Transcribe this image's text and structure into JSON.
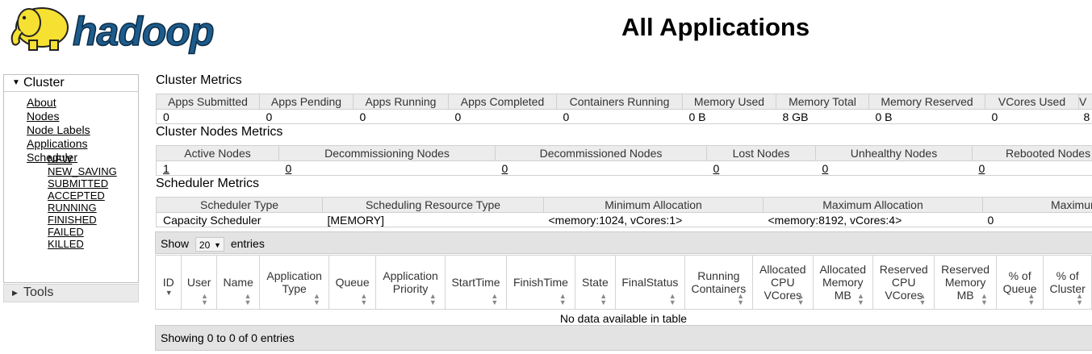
{
  "header": {
    "logo_text": "hadoop",
    "title": "All Applications"
  },
  "sidebar": {
    "cluster": {
      "label": "Cluster",
      "links": [
        "About",
        "Nodes",
        "Node Labels",
        "Applications"
      ],
      "app_states": [
        "NEW",
        "NEW_SAVING",
        "SUBMITTED",
        "ACCEPTED",
        "RUNNING",
        "FINISHED",
        "FAILED",
        "KILLED"
      ],
      "scheduler": "Scheduler"
    },
    "tools": {
      "label": "Tools"
    }
  },
  "cluster_metrics": {
    "title": "Cluster Metrics",
    "headers": [
      "Apps Submitted",
      "Apps Pending",
      "Apps Running",
      "Apps Completed",
      "Containers Running",
      "Memory Used",
      "Memory Total",
      "Memory Reserved",
      "VCores Used",
      "V"
    ],
    "values": [
      "0",
      "0",
      "0",
      "0",
      "0",
      "0 B",
      "8 GB",
      "0 B",
      "0",
      "8"
    ]
  },
  "node_metrics": {
    "title": "Cluster Nodes Metrics",
    "headers": [
      "Active Nodes",
      "Decommissioning Nodes",
      "Decommissioned Nodes",
      "Lost Nodes",
      "Unhealthy Nodes",
      "Rebooted Nodes"
    ],
    "values": [
      "1",
      "0",
      "0",
      "0",
      "0",
      "0"
    ]
  },
  "scheduler_metrics": {
    "title": "Scheduler Metrics",
    "headers": [
      "Scheduler Type",
      "Scheduling Resource Type",
      "Minimum Allocation",
      "Maximum Allocation",
      "Maximum"
    ],
    "values": [
      "Capacity Scheduler",
      "[MEMORY]",
      "<memory:1024, vCores:1>",
      "<memory:8192, vCores:4>",
      "0"
    ]
  },
  "apps_table": {
    "show_label": "Show",
    "page_length": "20",
    "entries_label": "entries",
    "columns": [
      "ID",
      "User",
      "Name",
      "Application Type",
      "Queue",
      "Application Priority",
      "StartTime",
      "FinishTime",
      "State",
      "FinalStatus",
      "Running Containers",
      "Allocated CPU VCores",
      "Allocated Memory MB",
      "Reserved CPU VCores",
      "Reserved Memory MB",
      "% of Queue",
      "% of Cluster"
    ],
    "empty_message": "No data available in table",
    "footer": "Showing 0 to 0 of 0 entries"
  },
  "colors": {
    "logo_blue": "#1d5c8c",
    "logo_yellow": "#f6e032",
    "header_bg": "#ececec",
    "toolbar_bg": "#e3e3e3"
  }
}
